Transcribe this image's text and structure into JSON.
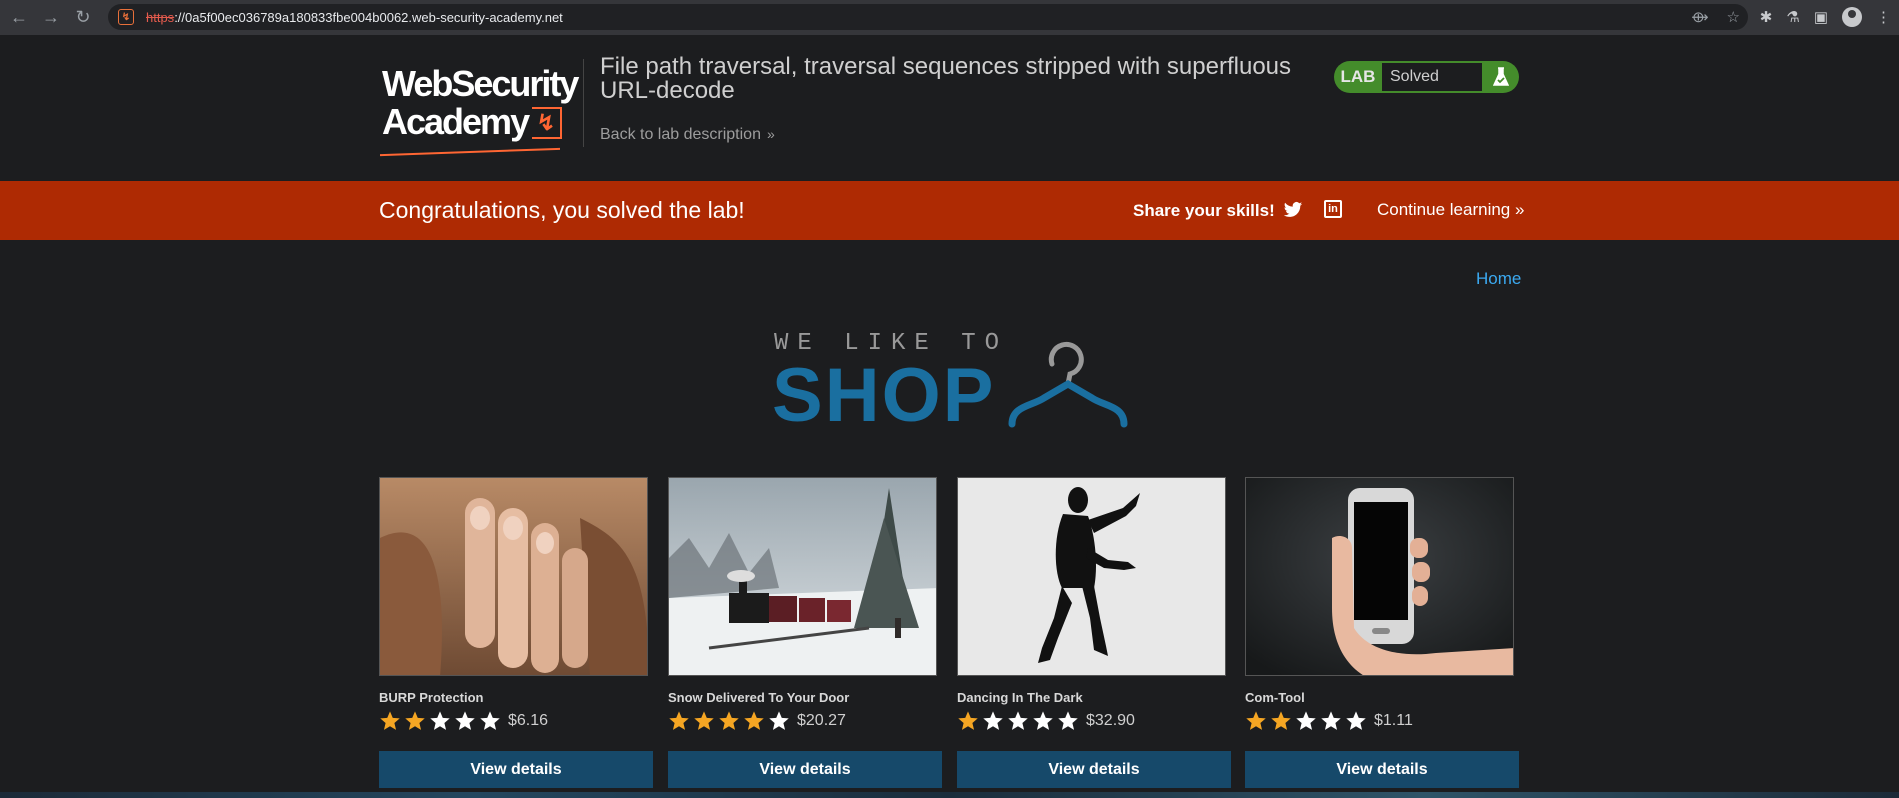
{
  "browser": {
    "url_scheme": "https",
    "url_rest": "://0a5f00ec036789a180833fbe004b0062.web-security-academy.net",
    "icons": [
      "back-icon",
      "forward-icon",
      "reload-icon",
      "share-icon",
      "bookmark-star-icon",
      "extensions-icon",
      "flask-extension-icon",
      "side-panel-icon",
      "profile-icon",
      "menu-icon"
    ]
  },
  "lab_header": {
    "logo_line1": "WebSecurity",
    "logo_line2": "Academy",
    "title": "File path traversal, traversal sequences stripped with superfluous URL-decode",
    "back_link": "Back to lab description",
    "badge_label": "LAB",
    "badge_status": "Solved"
  },
  "banner": {
    "congrats": "Congratulations, you solved the lab!",
    "share": "Share your skills!",
    "continue": "Continue learning"
  },
  "nav": {
    "home": "Home"
  },
  "shop_logo": {
    "small": "WE LIKE TO",
    "big": "SHOP"
  },
  "products": [
    {
      "name": "BURP Protection",
      "rating": 2,
      "price": "$6.16",
      "button": "View details"
    },
    {
      "name": "Snow Delivered To Your Door",
      "rating": 4,
      "price": "$20.27",
      "button": "View details"
    },
    {
      "name": "Dancing In The Dark",
      "rating": 1,
      "price": "$32.90",
      "button": "View details"
    },
    {
      "name": "Com-Tool",
      "rating": 2,
      "price": "$1.11",
      "button": "View details"
    }
  ],
  "colors": {
    "banner": "#ae2a03",
    "badge": "#448c2b",
    "button": "#16496a",
    "link": "#3ba9f0",
    "star_filled": "#f5a623",
    "star_empty": "#ffffff"
  }
}
